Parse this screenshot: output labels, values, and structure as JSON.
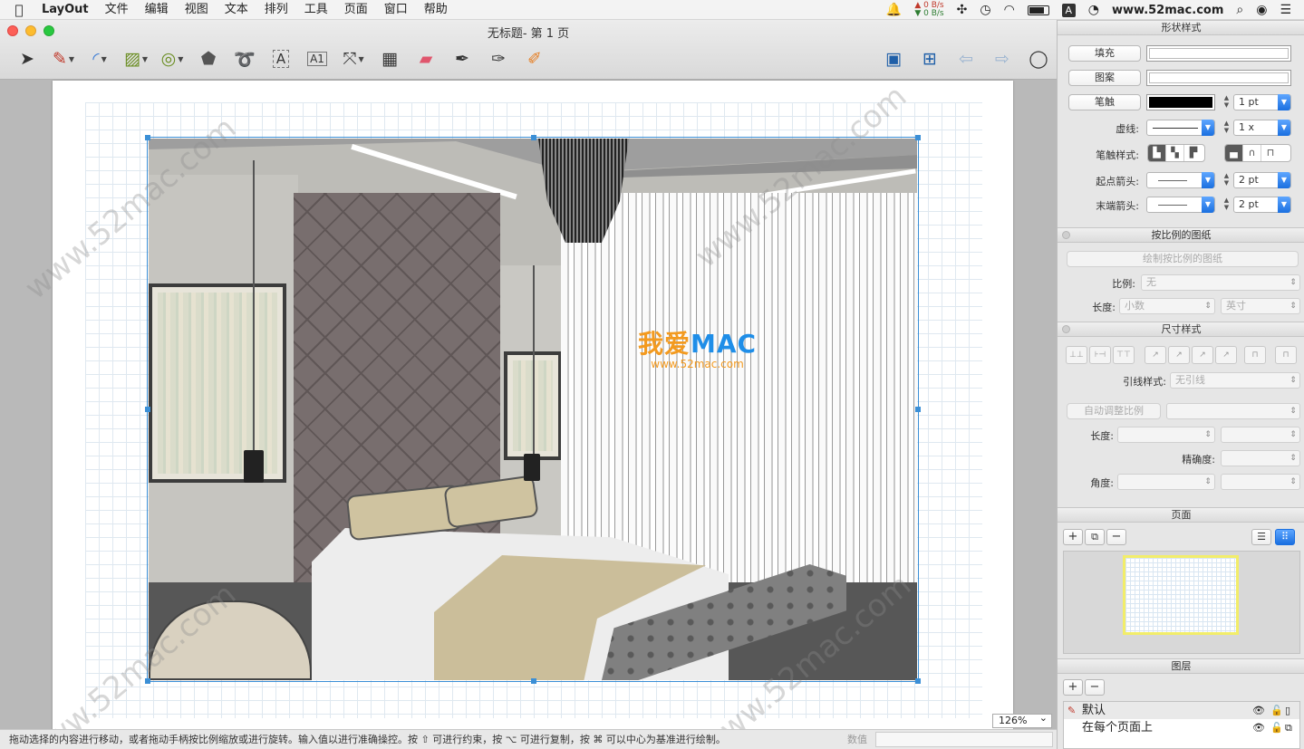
{
  "menubar": {
    "app_name": "LayOut",
    "items": [
      "文件",
      "编辑",
      "视图",
      "文本",
      "排列",
      "工具",
      "页面",
      "窗口",
      "帮助"
    ],
    "net_up": "0 B/s",
    "net_down": "0 B/s",
    "keyboard_indicator": "A",
    "site": "www.52mac.com"
  },
  "window": {
    "title": "无标题- 第 1 页",
    "zoom": "126%"
  },
  "watermarks": {
    "text": "www.52mac.com",
    "logo_main": "我爱",
    "logo_mac": "MAC",
    "logo_url": "www.52mac.com"
  },
  "statusbar": {
    "hint": "拖动选择的内容进行移动，或者拖动手柄按比例缩放或进行旋转。输入值以进行准确操控。按 ⇧ 可进行约束，按 ⌥ 可进行复制，按 ⌘ 可以中心为基准进行绘制。",
    "value_label": "数值"
  },
  "shape_style": {
    "header": "形状样式",
    "fill_label": "填充",
    "pattern_label": "图案",
    "stroke_label": "笔触",
    "stroke_width": "1 pt",
    "dash_label": "虚线:",
    "dash_scale": "1 x",
    "stroke_style_label": "笔触样式:",
    "start_arrow_label": "起点箭头:",
    "start_arrow_size": "2 pt",
    "end_arrow_label": "末端箭头:",
    "end_arrow_size": "2 pt"
  },
  "scaled_drawing": {
    "header": "按比例的图纸",
    "make_button": "绘制按比例的图纸",
    "scale_label": "比例:",
    "scale_value": "无",
    "length_label": "长度:",
    "length_format": "小数",
    "length_unit": "英寸"
  },
  "dimension_style": {
    "header": "尺寸样式",
    "leader_label": "引线样式:",
    "leader_value": "无引线",
    "auto_scale_button": "自动调整比例",
    "length_label": "长度:",
    "precision_label": "精确度:",
    "angle_label": "角度:"
  },
  "pages": {
    "header": "页面"
  },
  "layers": {
    "header": "图层",
    "items": [
      {
        "name": "默认"
      },
      {
        "name": "在每个页面上"
      }
    ]
  },
  "colors": {
    "selection": "#3b8fd6",
    "accent": "#1a6fe0"
  }
}
